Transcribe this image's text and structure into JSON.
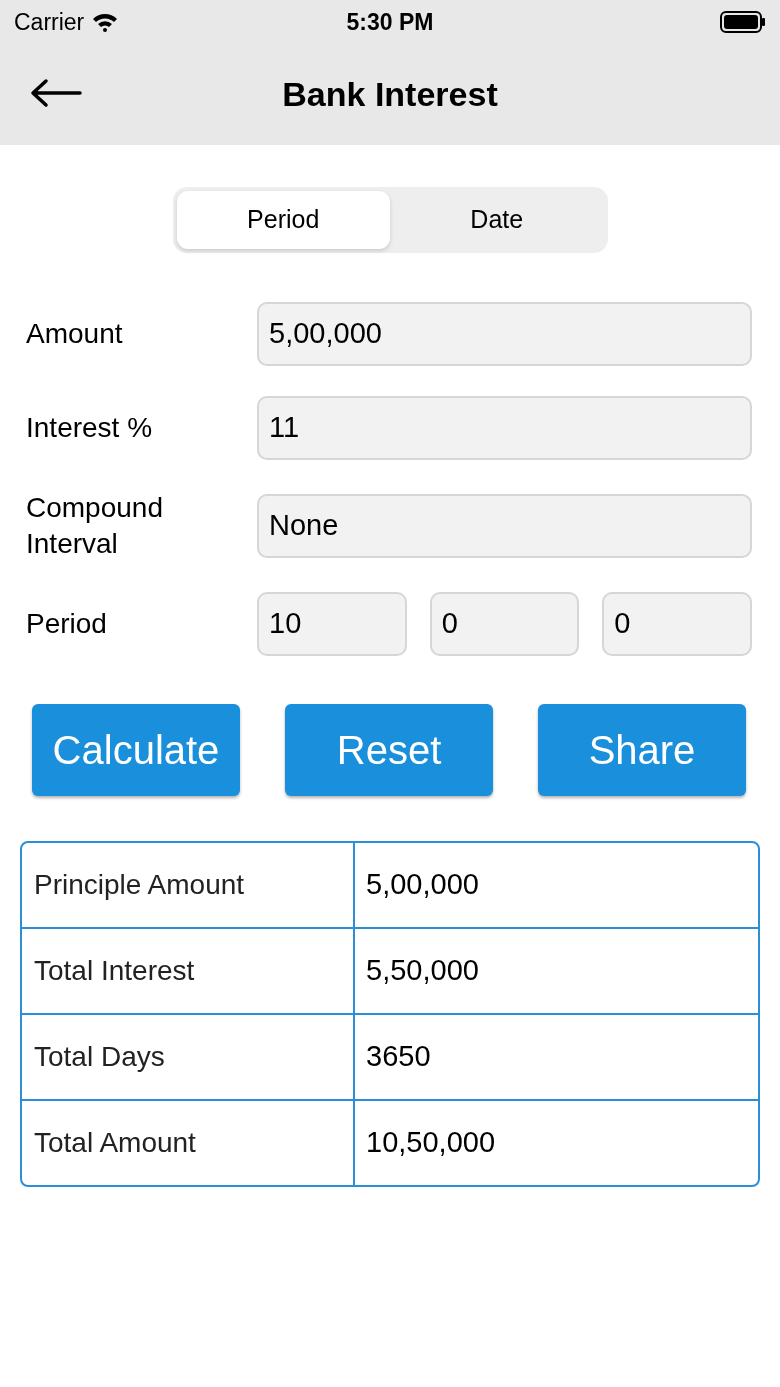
{
  "status_bar": {
    "carrier": "Carrier",
    "time": "5:30 PM"
  },
  "nav_bar": {
    "title": "Bank Interest"
  },
  "segments": [
    {
      "label": "Period",
      "selected": true
    },
    {
      "label": "Date",
      "selected": false
    }
  ],
  "form": [
    {
      "label": "Amount",
      "values": [
        "5,00,000"
      ]
    },
    {
      "label": "Interest %",
      "values": [
        "11"
      ]
    },
    {
      "label": "Compound Interval",
      "values": [
        "None"
      ]
    },
    {
      "label": "Period",
      "values": [
        "10",
        "0",
        "0"
      ]
    }
  ],
  "buttons": [
    "Calculate",
    "Reset",
    "Share"
  ],
  "results": [
    {
      "label": "Principle Amount",
      "value": "5,00,000"
    },
    {
      "label": "Total Interest",
      "value": "5,50,000"
    },
    {
      "label": "Total Days",
      "value": "3650"
    },
    {
      "label": "Total Amount",
      "value": "10,50,000"
    }
  ]
}
